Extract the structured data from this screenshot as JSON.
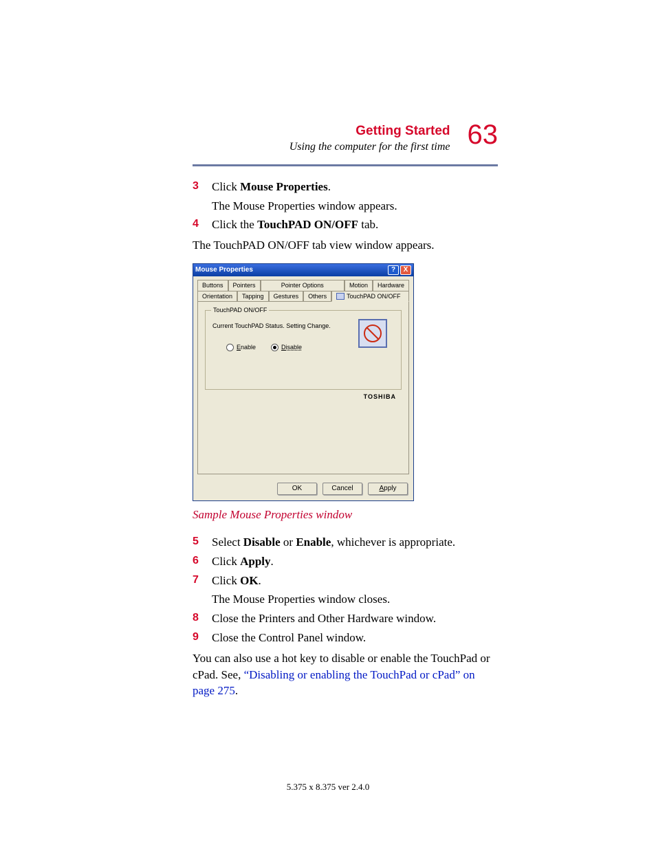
{
  "header": {
    "section": "Getting Started",
    "subtitle": "Using the computer for the first time",
    "page_number": "63"
  },
  "steps_a": [
    {
      "n": "3",
      "pre": "Click ",
      "b": "Mouse Properties",
      "post": ".",
      "after": "The Mouse Properties window appears."
    },
    {
      "n": "4",
      "pre": "Click the ",
      "b": "TouchPAD ON/OFF",
      "post": " tab."
    }
  ],
  "after_step4": "The TouchPAD ON/OFF tab view window appears.",
  "dialog": {
    "title": "Mouse Properties",
    "tabs_row1": [
      "Buttons",
      "Pointers",
      "Pointer Options",
      "Motion",
      "Hardware"
    ],
    "tabs_row2": [
      "Orientation",
      "Tapping",
      "Gestures",
      "Others",
      "TouchPAD ON/OFF"
    ],
    "group_legend": "TouchPAD ON/OFF",
    "status": "Current TouchPAD Status. Setting Change.",
    "radio_enable": "Enable",
    "radio_disable": "Disable",
    "brand": "TOSHIBA",
    "buttons": {
      "ok": "OK",
      "cancel": "Cancel",
      "apply": "Apply"
    }
  },
  "caption": "Sample Mouse Properties window",
  "steps_b": [
    {
      "n": "5",
      "pre": "Select ",
      "b": "Disable",
      "mid": " or ",
      "b2": "Enable",
      "post": ", whichever is appropriate."
    },
    {
      "n": "6",
      "pre": "Click ",
      "b": "Apply",
      "post": "."
    },
    {
      "n": "7",
      "pre": "Click ",
      "b": "OK",
      "post": ".",
      "after": "The Mouse Properties window closes."
    },
    {
      "n": "8",
      "pre": "Close the Printers and Other Hardware window."
    },
    {
      "n": "9",
      "pre": "Close the Control Panel window."
    }
  ],
  "closing_pre": "You can also use a hot key to disable or enable the TouchPad or cPad. See, ",
  "closing_link": "“Disabling or enabling the TouchPad or cPad” on page 275",
  "closing_post": ".",
  "footer": "5.375 x 8.375 ver 2.4.0"
}
